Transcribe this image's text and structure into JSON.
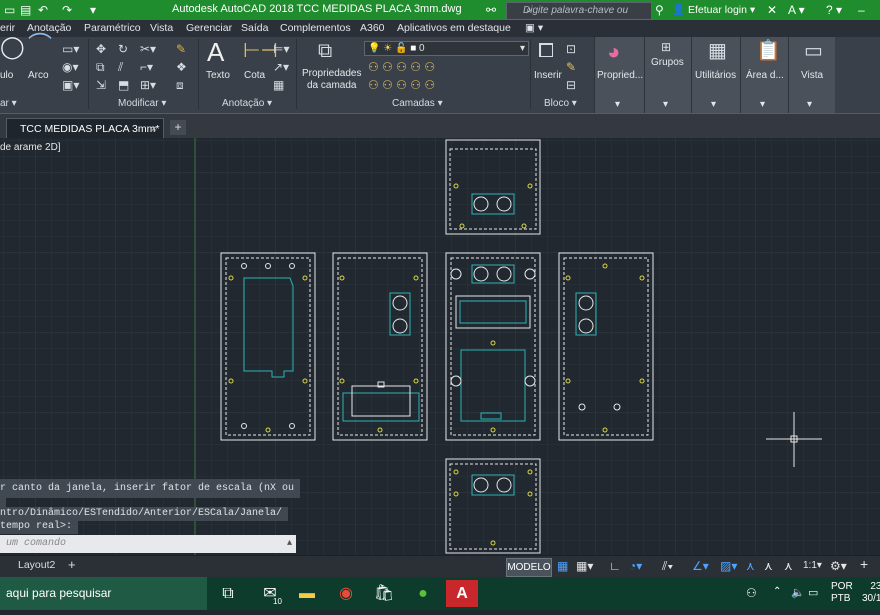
{
  "window": {
    "title": "Autodesk AutoCAD 2018    TCC MEDIDAS PLACA 3mm.dwg",
    "search_placeholder": "Digite palavra-chave ou frase",
    "login": "Efetuar login"
  },
  "menu": [
    "erir",
    "Anotação",
    "Paramétrico",
    "Vista",
    "Gerenciar",
    "Saída",
    "Complementos",
    "A360",
    "Aplicativos em destaque"
  ],
  "ribbon": {
    "draw_tools": {
      "ulo": "ulo",
      "arco": "Arco"
    },
    "text_tool": "Texto",
    "cota_tool": "Cota",
    "layer_props": "Propriedades\nda camada",
    "layer_value": "0",
    "insert_tool": "Inserir",
    "properties_tool": "Propried...",
    "groups_tool": "Grupos",
    "utilities_tool": "Utilitários",
    "clipboard_tool": "Área d...",
    "view_tool": "Vista",
    "panels": {
      "draw": "ar",
      "modify": "Modificar",
      "annotation": "Anotação",
      "layers": "Camadas",
      "block": "Bloco"
    }
  },
  "tabs": {
    "document": "TCC MEDIDAS PLACA 3mm*",
    "close": "×",
    "add": "+"
  },
  "viewport": {
    "label": "de arame 2D]"
  },
  "command": {
    "history": [
      "r canto da janela, inserir fator de escala (nX ou",
      "ntro/Dinâmico/ESTendido/Anterior/ESCala/Janela/",
      "tempo real>:"
    ],
    "input_placeholder": "um comando"
  },
  "layout_tabs": {
    "layout2": "Layout2",
    "add": "+"
  },
  "statusbar": {
    "model": "MODELO",
    "scale": "1:1"
  },
  "taskbar": {
    "search": "aqui para pesquisar",
    "mail_badge": "10",
    "lang_top": "POR",
    "lang_bottom": "PTB",
    "time": "23",
    "date": "30/1"
  }
}
